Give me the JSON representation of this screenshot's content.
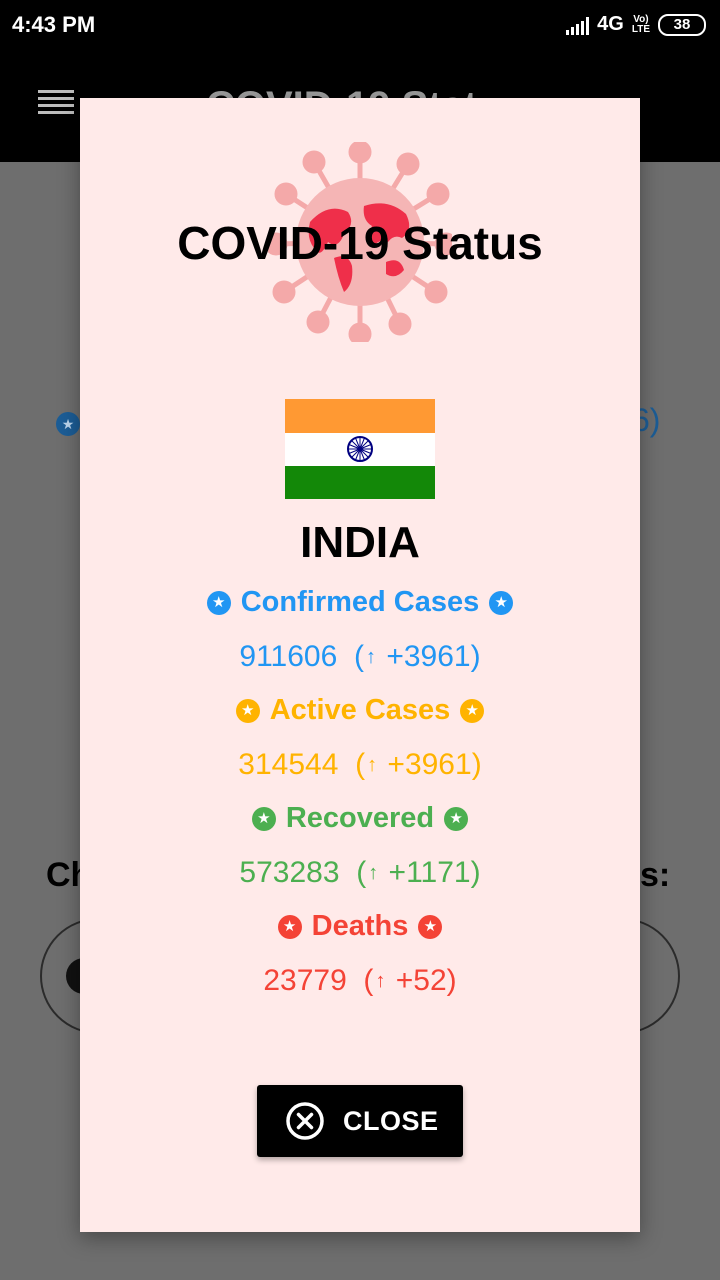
{
  "status_bar": {
    "time": "4:43 PM",
    "network": "4G",
    "volte_line1": "Vo)",
    "volte_line2": "LTE",
    "battery": "38"
  },
  "app_bar": {
    "title": "COVID-19 Stat"
  },
  "background": {
    "partial_right_value": "6)",
    "check_left": "Ch",
    "check_right": "s:"
  },
  "dialog": {
    "title": "COVID-19 Status",
    "country": "INDIA",
    "stats": [
      {
        "label": "Confirmed Cases",
        "value": "911606",
        "delta": "+3961",
        "color": "#2196f3"
      },
      {
        "label": "Active Cases",
        "value": "314544",
        "delta": "+3961",
        "color": "#ffb300"
      },
      {
        "label": "Recovered",
        "value": "573283",
        "delta": "+1171",
        "color": "#4caf50"
      },
      {
        "label": "Deaths",
        "value": "23779",
        "delta": "+52",
        "color": "#f44336"
      }
    ],
    "close_label": "CLOSE",
    "icons": {
      "close": "close-circle-icon",
      "star": "star-badge-icon",
      "arrow": "up-arrow-icon",
      "virus": "virus-globe-icon",
      "flag": "india-flag-icon"
    }
  }
}
